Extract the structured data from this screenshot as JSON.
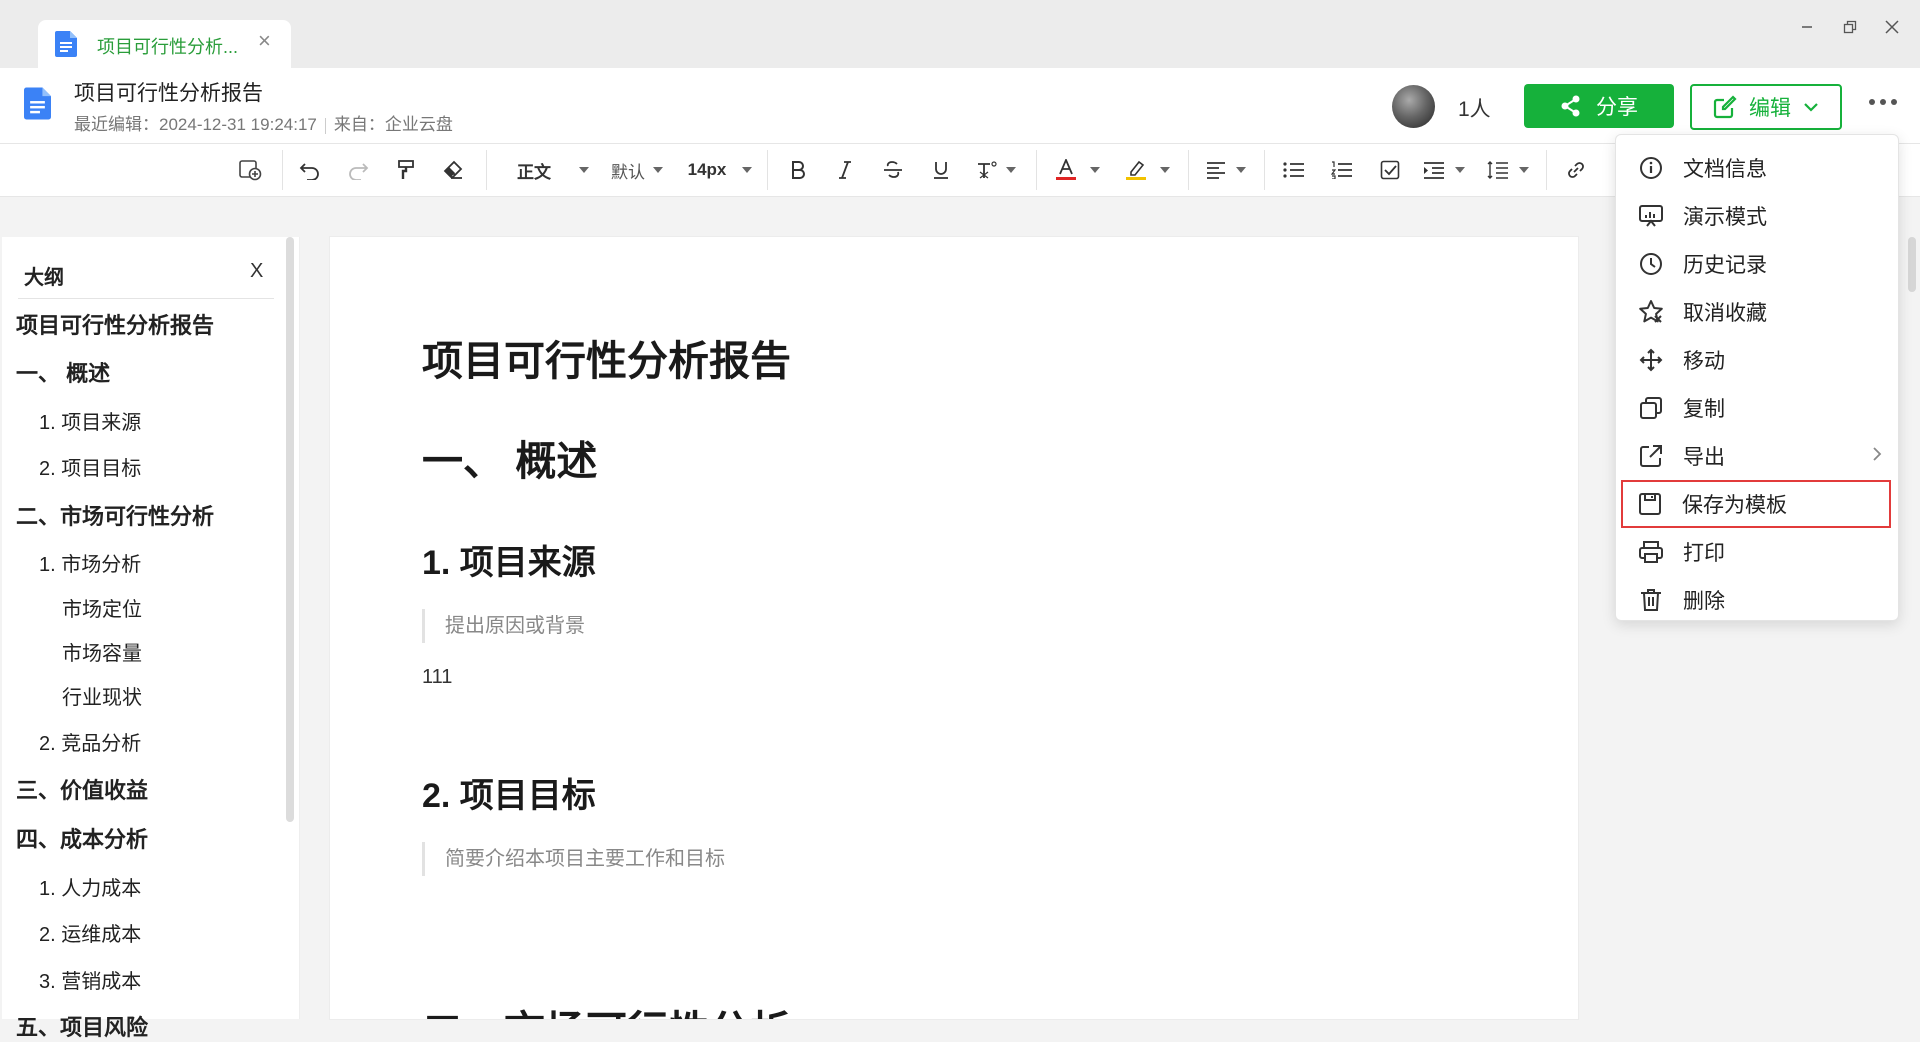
{
  "tab": {
    "title": "项目可行性分析...",
    "close": "×"
  },
  "header": {
    "title": "项目可行性分析报告",
    "last_edit": "最近编辑：2024-12-31 19:24:17",
    "source": "来自：企业云盘",
    "people": "1人",
    "share_label": "分享",
    "edit_label": "编辑"
  },
  "toolbar": {
    "style": "正文",
    "font": "默认",
    "size": "14px",
    "text_color": "#e02424",
    "highlight_color": "#f2c200"
  },
  "outline": {
    "title": "大纲",
    "close": "X",
    "items": [
      {
        "label": "项目可行性分析报告",
        "level": 1
      },
      {
        "label": "一、 概述",
        "level": 1
      },
      {
        "label": "1. 项目来源",
        "level": 2
      },
      {
        "label": "2. 项目目标",
        "level": 2
      },
      {
        "label": "二、市场可行性分析",
        "level": 1
      },
      {
        "label": "1. 市场分析",
        "level": 2
      },
      {
        "label": "市场定位",
        "level": 3
      },
      {
        "label": "市场容量",
        "level": 3
      },
      {
        "label": "行业现状",
        "level": 3
      },
      {
        "label": "2. 竞品分析",
        "level": 2
      },
      {
        "label": "三、价值收益",
        "level": 1
      },
      {
        "label": "四、成本分析",
        "level": 1
      },
      {
        "label": "1. 人力成本",
        "level": 2
      },
      {
        "label": "2. 运维成本",
        "level": 2
      },
      {
        "label": "3. 营销成本",
        "level": 2
      },
      {
        "label": "五、项目风险",
        "level": 1
      }
    ]
  },
  "document": {
    "title": "项目可行性分析报告",
    "section1": "一、  概述",
    "h_source": "1. 项目来源",
    "q_source": "提出原因或背景",
    "p_source": "111",
    "h_goal": "2. 项目目标",
    "q_goal": "简要介绍本项目主要工作和目标",
    "section2": "二、市场可行性分析"
  },
  "menu": {
    "items": [
      {
        "label": "文档信息",
        "icon": "info-icon"
      },
      {
        "label": "演示模式",
        "icon": "presentation-icon"
      },
      {
        "label": "历史记录",
        "icon": "clock-icon"
      },
      {
        "label": "取消收藏",
        "icon": "star-off-icon"
      },
      {
        "label": "移动",
        "icon": "move-icon"
      },
      {
        "label": "复制",
        "icon": "copy-icon"
      },
      {
        "label": "导出",
        "icon": "export-icon"
      },
      {
        "label": "保存为模板",
        "icon": "save-template-icon"
      },
      {
        "label": "打印",
        "icon": "print-icon"
      },
      {
        "label": "删除",
        "icon": "trash-icon"
      }
    ]
  },
  "colors": {
    "brand_green": "#16b13b",
    "highlight_border": "#e23b3b"
  }
}
